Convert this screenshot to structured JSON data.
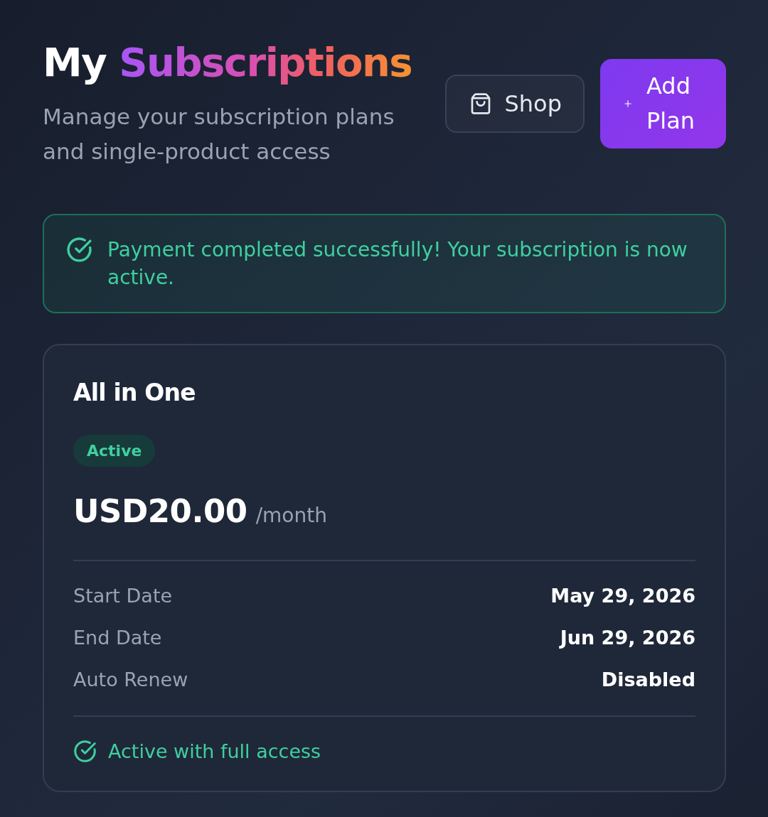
{
  "header": {
    "title": {
      "lead": "My",
      "highlight": "Subscriptions"
    },
    "subtitle": "Manage your subscription plans and single-product access",
    "buttons": [
      {
        "kind": "outline",
        "label": "Shop"
      },
      {
        "kind": "primary",
        "label": "Add Plan"
      }
    ]
  },
  "alert": {
    "kind": "success",
    "message": "Payment completed successfully! Your subscription is now active."
  },
  "subscription": {
    "name": "All in One",
    "status": {
      "kind": "active",
      "label": "Active"
    },
    "price": "USD20.00",
    "period": "/month",
    "details": [
      {
        "label": "Start Date",
        "value": "May 29, 2026"
      },
      {
        "label": "End Date",
        "value": "Jun 29, 2026"
      },
      {
        "label": "Auto Renew",
        "value": "Disabled"
      }
    ],
    "footer": {
      "kind": "active",
      "text": "Active with full access"
    }
  }
}
